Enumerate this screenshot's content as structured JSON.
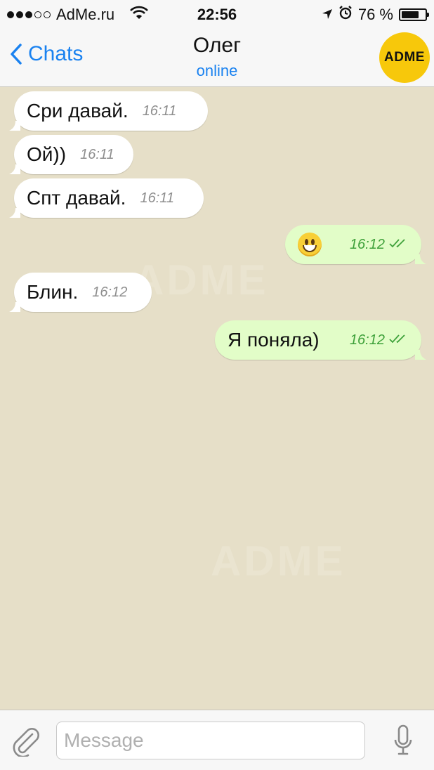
{
  "status_bar": {
    "carrier": "AdMe.ru",
    "time": "22:56",
    "battery": "76 %",
    "battery_level": 0.76
  },
  "header": {
    "back_label": "Chats",
    "title": "Олег",
    "subtitle": "online",
    "avatar_text": "ADME"
  },
  "messages": [
    {
      "direction": "in",
      "text": "Сри давай.",
      "time": "16:11"
    },
    {
      "direction": "in",
      "text": "Ой))",
      "time": "16:11"
    },
    {
      "direction": "in",
      "text": "Спт давай.",
      "time": "16:11"
    },
    {
      "direction": "out",
      "text": "",
      "emoji": "grinning-face",
      "time": "16:12"
    },
    {
      "direction": "in",
      "text": "Блин.",
      "time": "16:12"
    },
    {
      "direction": "out",
      "text": "Я поняла)",
      "time": "16:12"
    }
  ],
  "input": {
    "placeholder": "Message"
  },
  "watermark": "ADME",
  "colors": {
    "accent": "#1a82f0",
    "outgoing_bubble": "#e2fdc8",
    "outgoing_time": "#3ea13a",
    "avatar": "#f7c80b",
    "chat_background": "#e6dfc8"
  }
}
